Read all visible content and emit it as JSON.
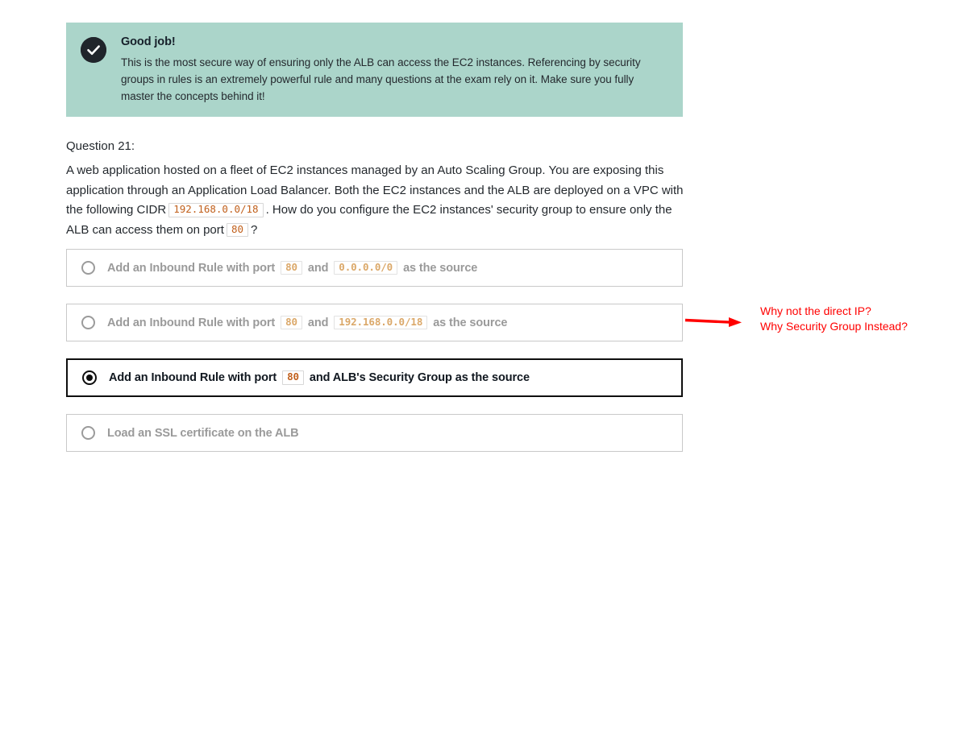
{
  "feedback": {
    "icon": "check-circle-icon",
    "title": "Good job!",
    "body": "This is the most secure way of ensuring only the ALB can access the EC2 instances. Referencing by security groups in rules is an extremely powerful rule and many questions at the exam rely on it. Make sure you fully master the concepts behind it!",
    "background_color": "#abd5ca",
    "icon_color": "#20252b"
  },
  "question": {
    "label": "Question 21:",
    "text_part_1": "A web application hosted on a fleet of EC2 instances managed by an Auto Scaling Group. You are exposing this application through an Application Load Balancer. Both the EC2 instances and the ALB are deployed on a VPC with the following CIDR",
    "cidr_code": "192.168.0.0/18",
    "text_part_2": ". How do you configure the EC2 instances' security group to ensure only the ALB can access them on port",
    "port_code": "80",
    "text_part_3": "?"
  },
  "options": [
    {
      "id": "option-1",
      "selected": false,
      "prefix": "Add an Inbound Rule with port",
      "port": "80",
      "middle": "and",
      "source": "0.0.0.0/0",
      "source_is_code": true,
      "suffix": "as the source"
    },
    {
      "id": "option-2",
      "selected": false,
      "prefix": "Add an Inbound Rule with port",
      "port": "80",
      "middle": "and",
      "source": "192.168.0.0/18",
      "source_is_code": true,
      "suffix": "as the source"
    },
    {
      "id": "option-3",
      "selected": true,
      "prefix": "Add an Inbound Rule with port",
      "port": "80",
      "middle": "",
      "source": "",
      "source_is_code": false,
      "suffix": "and ALB's Security Group as the source"
    },
    {
      "id": "option-4",
      "selected": false,
      "prefix": "Load an SSL certificate on the ALB",
      "port": "",
      "middle": "",
      "source": "",
      "source_is_code": false,
      "suffix": ""
    }
  ],
  "annotation": {
    "color": "#ff0000",
    "arrow": "right-arrow-icon",
    "line_1": "Why not the direct IP?",
    "line_2": "Why Security Group Instead?"
  }
}
